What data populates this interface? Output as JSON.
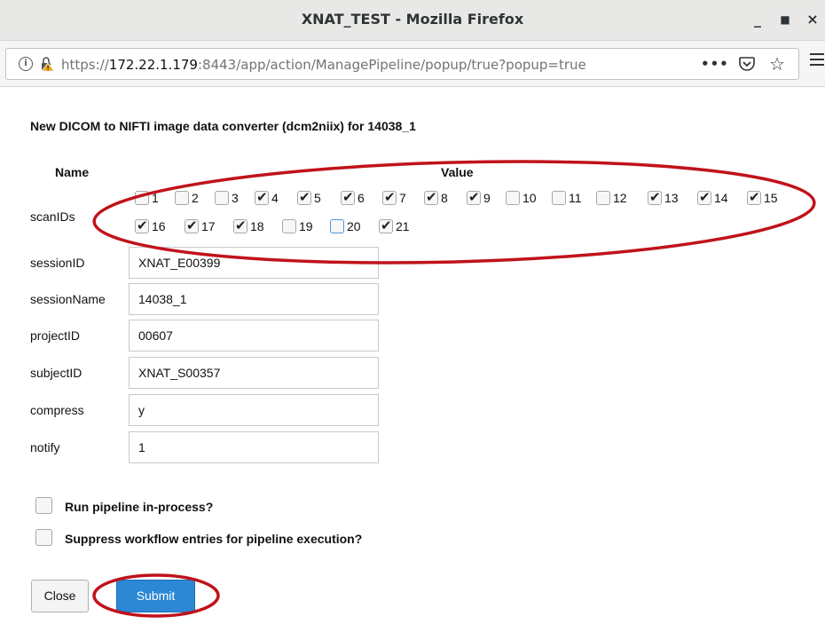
{
  "window": {
    "title": "XNAT_TEST - Mozilla Firefox",
    "minimize_label": "_",
    "maximize_label": "■",
    "close_label": "×"
  },
  "navbar": {
    "url_prefix": "https://",
    "url_host": "172.22.1.179",
    "url_rest": ":8443/app/action/ManagePipeline/popup/true?popup=true",
    "more_label": "•••"
  },
  "form": {
    "heading": "New DICOM to NIFTI image data converter (dcm2niix) for 14038_1",
    "col_name": "Name",
    "col_value": "Value",
    "scan_label": "scanIDs",
    "scans": [
      {
        "id": "1",
        "checked": false
      },
      {
        "id": "2",
        "checked": false
      },
      {
        "id": "3",
        "checked": false
      },
      {
        "id": "4",
        "checked": true
      },
      {
        "id": "5",
        "checked": true
      },
      {
        "id": "6",
        "checked": true
      },
      {
        "id": "7",
        "checked": true
      },
      {
        "id": "8",
        "checked": true
      },
      {
        "id": "9",
        "checked": true
      },
      {
        "id": "10",
        "checked": false
      },
      {
        "id": "11",
        "checked": false
      },
      {
        "id": "12",
        "checked": false
      },
      {
        "id": "13",
        "checked": true
      },
      {
        "id": "14",
        "checked": true
      },
      {
        "id": "15",
        "checked": true
      },
      {
        "id": "16",
        "checked": true
      },
      {
        "id": "17",
        "checked": true
      },
      {
        "id": "18",
        "checked": true
      },
      {
        "id": "19",
        "checked": false
      },
      {
        "id": "20",
        "checked": false
      },
      {
        "id": "21",
        "checked": true
      }
    ],
    "fields": [
      {
        "label": "sessionID",
        "value": "XNAT_E00399"
      },
      {
        "label": "sessionName",
        "value": "14038_1"
      },
      {
        "label": "projectID",
        "value": "00607"
      },
      {
        "label": "subjectID",
        "value": "XNAT_S00357"
      },
      {
        "label": "compress",
        "value": "y"
      },
      {
        "label": "notify",
        "value": "1"
      }
    ],
    "options": [
      {
        "label": "Run pipeline in-process?",
        "checked": false
      },
      {
        "label": "Suppress workflow entries for pipeline execution?",
        "checked": false
      }
    ],
    "close_label": "Close",
    "submit_label": "Submit"
  },
  "colors": {
    "annotation": "#c0121b",
    "submit_bg": "#2c87d4"
  }
}
